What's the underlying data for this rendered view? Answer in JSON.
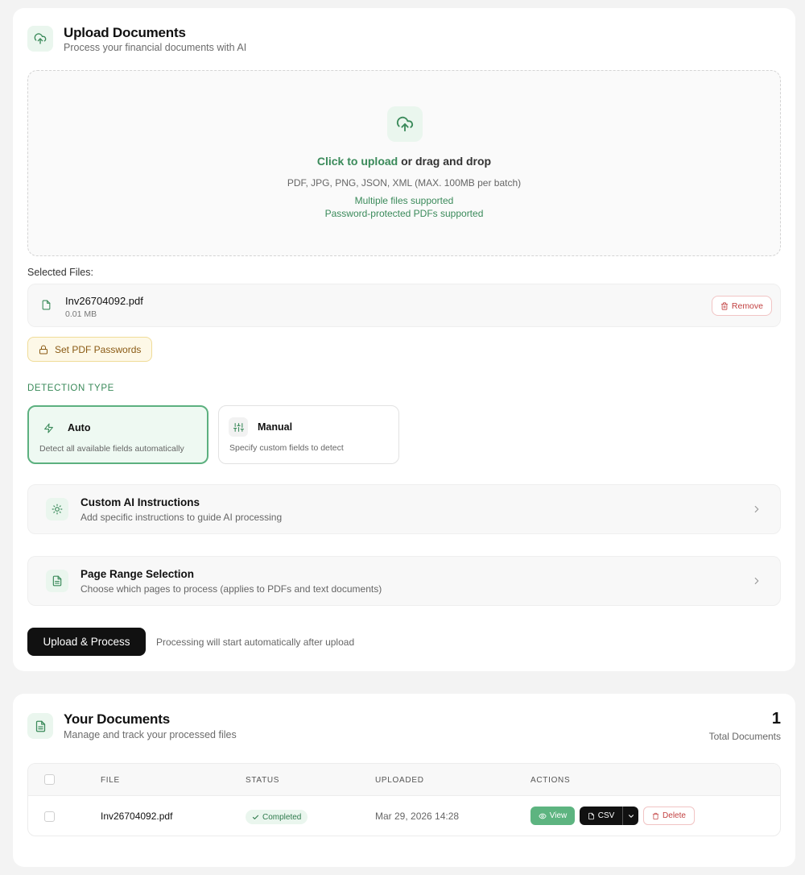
{
  "upload": {
    "title": "Upload Documents",
    "subtitle": "Process your financial documents with AI",
    "dropzone": {
      "link": "Click to upload",
      "rest": " or drag and drop",
      "formats": "PDF, JPG, PNG, JSON, XML (MAX. 100MB per batch)",
      "multi": "Multiple files supported",
      "password": "Password-protected PDFs supported"
    },
    "selected_label": "Selected Files:",
    "files": [
      {
        "name": "Inv26704092.pdf",
        "size": "0.01 MB",
        "remove_label": "Remove"
      }
    ],
    "password_button": "Set PDF Passwords",
    "detection": {
      "label": "DETECTION TYPE",
      "options": [
        {
          "name": "Auto",
          "desc": "Detect all available fields automatically",
          "selected": true
        },
        {
          "name": "Manual",
          "desc": "Specify custom fields to detect",
          "selected": false
        }
      ]
    },
    "custom_ai": {
      "title": "Custom AI Instructions",
      "subtitle": "Add specific instructions to guide AI processing"
    },
    "page_range": {
      "title": "Page Range Selection",
      "subtitle": "Choose which pages to process (applies to PDFs and text documents)"
    },
    "primary_button": "Upload & Process",
    "note": "Processing will start automatically after upload"
  },
  "documents": {
    "title": "Your Documents",
    "subtitle": "Manage and track your processed files",
    "total_count": "1",
    "total_label": "Total Documents",
    "columns": [
      "FILE",
      "STATUS",
      "UPLOADED",
      "ACTIONS"
    ],
    "rows": [
      {
        "file": "Inv26704092.pdf",
        "status": "Completed",
        "uploaded": "Mar 29, 2026 14:28",
        "view": "View",
        "csv": "CSV",
        "delete": "Delete"
      }
    ]
  },
  "colors": {
    "accent": "#3a8a5a",
    "danger": "#c24040",
    "primary": "#111111"
  },
  "icons": [
    "cloud-upload-icon",
    "file-icon",
    "trash-icon",
    "lock-icon",
    "zap-icon",
    "sliders-icon",
    "lightbulb-icon",
    "file-text-icon",
    "chevron-right-icon",
    "check-icon",
    "eye-icon",
    "chevron-down-icon"
  ]
}
